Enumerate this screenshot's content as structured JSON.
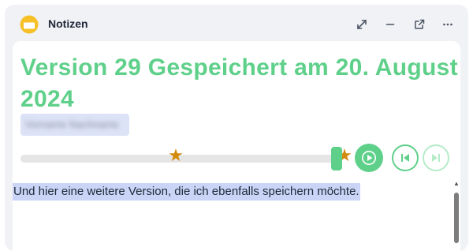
{
  "header": {
    "app_title": "Notizen",
    "app_icon": "notes-icon",
    "actions": [
      "expand-icon",
      "minimize-icon",
      "external-link-icon",
      "more-icon"
    ]
  },
  "version": {
    "title": "Version 29 Gespeichert am 20. August 2024",
    "author": "Vorname Nachname"
  },
  "timeline": {
    "stars": [
      "star-icon",
      "star-icon"
    ],
    "position_fraction": 1.0
  },
  "controls": [
    "play-icon",
    "skip-previous-icon",
    "skip-next-icon"
  ],
  "editor": {
    "text": "Und hier eine weitere Version, die ich ebenfalls speichern möchte."
  },
  "colors": {
    "accent": "#5fd08a",
    "accent_light": "#b5ebc9",
    "star": "#d48a0d",
    "selection": "#c9d4f7",
    "panel": "#f1f2f6"
  }
}
